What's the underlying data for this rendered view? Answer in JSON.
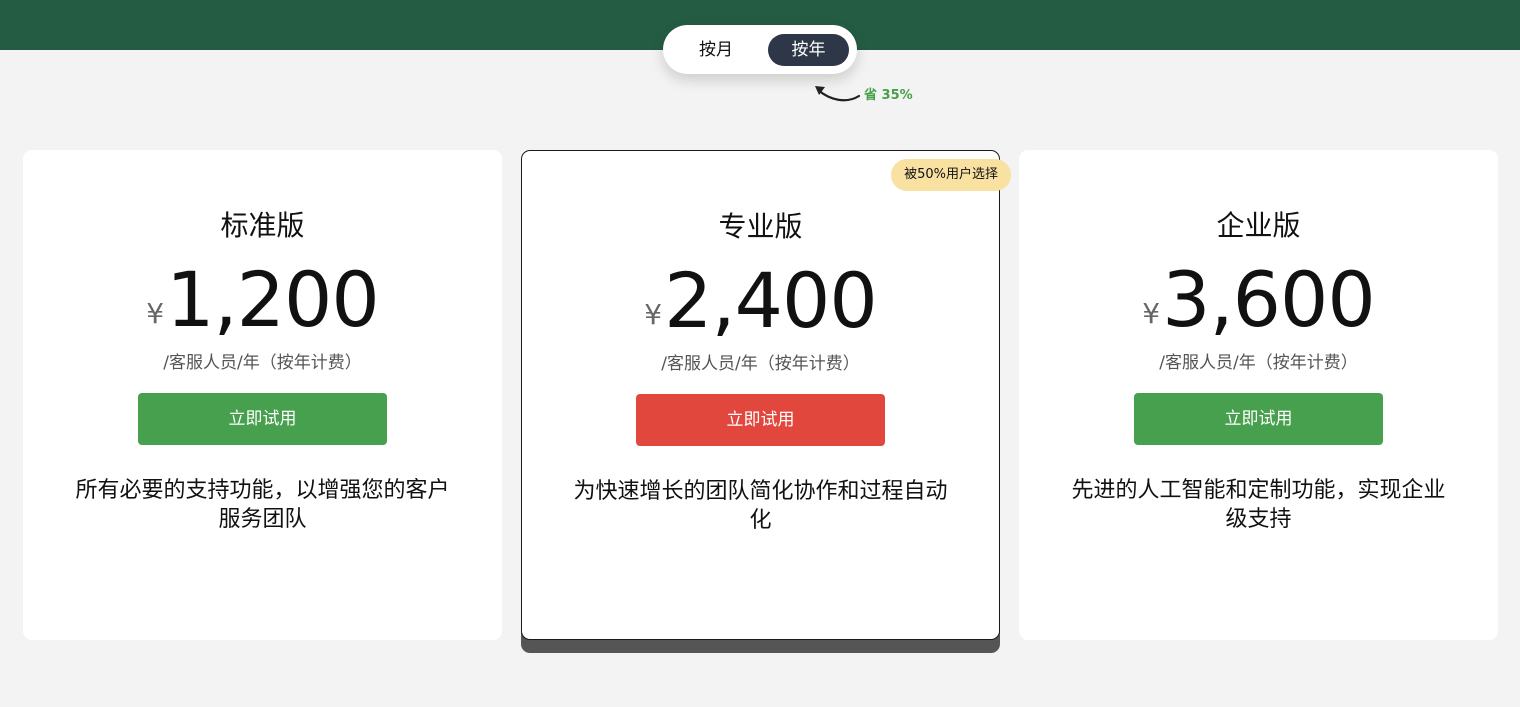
{
  "billing_toggle": {
    "monthly_label": "按月",
    "yearly_label": "按年",
    "selected": "yearly",
    "savings_note": "省 35%"
  },
  "colors": {
    "header": "#245c43",
    "cta_green": "#46a04d",
    "cta_red": "#e2473d",
    "badge": "#f8e1a1",
    "toggle_active": "#2d3748",
    "savings_text": "#45a049"
  },
  "plans": [
    {
      "name": "标准版",
      "currency": "¥",
      "price": "1,200",
      "unit": "/客服人员/年（按年计费）",
      "cta_label": "立即试用",
      "description": "所有必要的支持功能，以增强您的客户服务团队"
    },
    {
      "name": "专业版",
      "badge": "被50%用户选择",
      "currency": "¥",
      "price": "2,400",
      "unit": "/客服人员/年（按年计费）",
      "cta_label": "立即试用",
      "description": "为快速增长的团队简化协作和过程自动化"
    },
    {
      "name": "企业版",
      "currency": "¥",
      "price": "3,600",
      "unit": "/客服人员/年（按年计费）",
      "cta_label": "立即试用",
      "description": "先进的人工智能和定制功能，实现企业级支持"
    }
  ]
}
